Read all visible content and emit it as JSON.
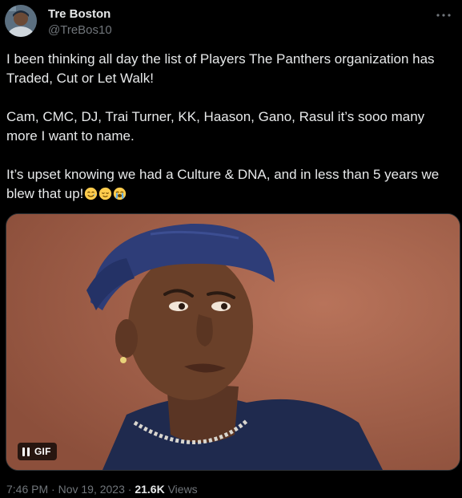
{
  "author": {
    "name": "Tre Boston",
    "handle": "@TreBos10",
    "avatar_icon": "profile-avatar"
  },
  "more_icon": "more-horizontal-icon",
  "tweet": {
    "paragraphs": [
      "I been thinking all day the list of Players The Panthers organization has Traded, Cut or Let Walk!",
      "Cam, CMC, DJ, Trai Turner, KK, Haason, Gano, Rasul it’s sooo many more I want to name.",
      "It’s upset knowing we had a Culture & DNA, and in less than 5 years we blew that up!"
    ],
    "emojis": [
      "smiling-face-with-tear-icon",
      "relieved-face-icon",
      "loudly-crying-face-icon"
    ]
  },
  "media": {
    "type": "gif",
    "badge_label": "GIF",
    "pause_icon": "pause-icon",
    "background_color": "#a06048"
  },
  "meta": {
    "time": "7:46 PM",
    "separator": "·",
    "date": "Nov 19, 2023",
    "views_count": "21.6K",
    "views_label": "Views"
  },
  "colors": {
    "background": "#000000",
    "text_primary": "#e7e9ea",
    "text_secondary": "#71767b",
    "border": "#2f3336"
  }
}
